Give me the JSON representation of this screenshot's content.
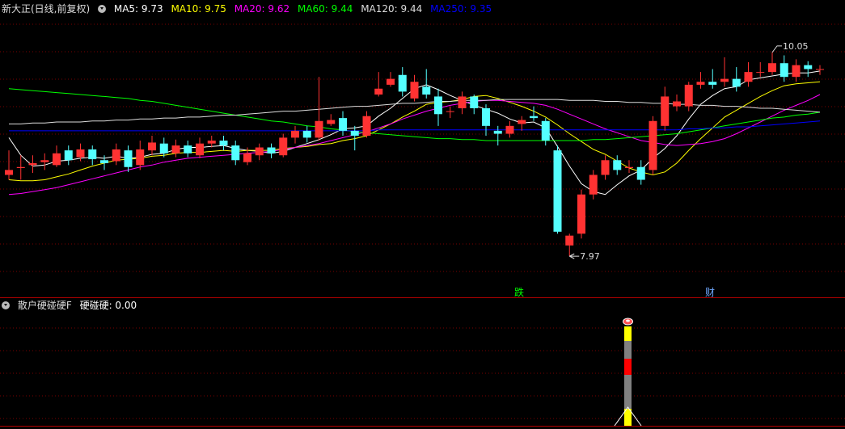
{
  "header": {
    "title": "新大正(日线,前复权)",
    "ma": [
      {
        "label": "MA5: 9.73",
        "color": "#ffffff"
      },
      {
        "label": "MA10: 9.75",
        "color": "#ffff00"
      },
      {
        "label": "MA20: 9.62",
        "color": "#ff00ff"
      },
      {
        "label": "MA60: 9.44",
        "color": "#00ff00"
      },
      {
        "label": "MA120: 9.44",
        "color": "#dddddd"
      },
      {
        "label": "MA250: 9.35",
        "color": "#0000ff"
      }
    ]
  },
  "indicator": {
    "title": "散户硬碰硬F",
    "value_label": "硬碰硬: 0.00"
  },
  "annotations": {
    "high": "10.05",
    "low": "7.97",
    "marker_die": "跌",
    "marker_cai": "财"
  },
  "chart_data": {
    "type": "candlestick",
    "ylim": [
      7.6,
      10.42
    ],
    "up_color": "#ff3232",
    "down_color": "#54ffff",
    "candles": [
      [
        8.8,
        8.85,
        9.05,
        8.75
      ],
      [
        8.87,
        8.88,
        9.0,
        8.75
      ],
      [
        8.9,
        8.92,
        9.0,
        8.82
      ],
      [
        8.93,
        8.95,
        9.02,
        8.85
      ],
      [
        8.9,
        9.02,
        9.1,
        8.88
      ],
      [
        9.05,
        8.95,
        9.1,
        8.9
      ],
      [
        8.98,
        9.06,
        9.12,
        8.94
      ],
      [
        9.06,
        8.96,
        9.1,
        8.9
      ],
      [
        8.95,
        8.92,
        9.0,
        8.85
      ],
      [
        8.94,
        9.06,
        9.12,
        8.9
      ],
      [
        9.05,
        8.88,
        9.1,
        8.83
      ],
      [
        8.9,
        9.06,
        9.15,
        8.85
      ],
      [
        9.05,
        9.13,
        9.2,
        9.0
      ],
      [
        9.12,
        9.02,
        9.18,
        8.98
      ],
      [
        9.02,
        9.1,
        9.16,
        8.98
      ],
      [
        9.1,
        9.02,
        9.15,
        8.98
      ],
      [
        9.0,
        9.12,
        9.18,
        8.97
      ],
      [
        9.12,
        9.15,
        9.2,
        9.08
      ],
      [
        9.15,
        9.1,
        9.2,
        9.05
      ],
      [
        9.1,
        8.95,
        9.15,
        8.9
      ],
      [
        8.93,
        9.02,
        9.08,
        8.9
      ],
      [
        9.0,
        9.08,
        9.12,
        8.95
      ],
      [
        9.08,
        9.02,
        9.12,
        8.97
      ],
      [
        9.0,
        9.18,
        9.22,
        8.98
      ],
      [
        9.18,
        9.25,
        9.3,
        9.12
      ],
      [
        9.25,
        9.18,
        9.3,
        9.13
      ],
      [
        9.18,
        9.35,
        9.8,
        9.15
      ],
      [
        9.32,
        9.36,
        9.42,
        9.3
      ],
      [
        9.38,
        9.25,
        9.45,
        9.2
      ],
      [
        9.25,
        9.2,
        9.3,
        9.05
      ],
      [
        9.2,
        9.4,
        9.45,
        9.18
      ],
      [
        9.62,
        9.68,
        9.85,
        9.6
      ],
      [
        9.72,
        9.78,
        9.85,
        9.7
      ],
      [
        9.82,
        9.65,
        9.9,
        9.6
      ],
      [
        9.58,
        9.75,
        9.82,
        9.55
      ],
      [
        9.7,
        9.62,
        9.88,
        9.58
      ],
      [
        9.6,
        9.42,
        9.68,
        9.3
      ],
      [
        9.45,
        9.45,
        9.5,
        9.38
      ],
      [
        9.48,
        9.6,
        9.65,
        9.42
      ],
      [
        9.6,
        9.48,
        9.62,
        9.42
      ],
      [
        9.48,
        9.3,
        9.52,
        9.2
      ],
      [
        9.25,
        9.22,
        9.3,
        9.1
      ],
      [
        9.22,
        9.3,
        9.35,
        9.18
      ],
      [
        9.32,
        9.36,
        9.4,
        9.25
      ],
      [
        9.4,
        9.38,
        9.5,
        9.35
      ],
      [
        9.35,
        9.15,
        9.38,
        9.1
      ],
      [
        9.05,
        8.22,
        9.1,
        8.2
      ],
      [
        8.08,
        8.18,
        8.2,
        7.97
      ],
      [
        8.2,
        8.6,
        8.65,
        8.15
      ],
      [
        8.6,
        8.8,
        8.85,
        8.55
      ],
      [
        8.8,
        8.95,
        9.0,
        8.75
      ],
      [
        8.95,
        8.85,
        9.0,
        8.8
      ],
      [
        8.87,
        8.88,
        8.95,
        8.82
      ],
      [
        8.88,
        8.75,
        8.95,
        8.7
      ],
      [
        8.85,
        9.35,
        9.4,
        8.8
      ],
      [
        9.3,
        9.6,
        9.7,
        9.25
      ],
      [
        9.5,
        9.55,
        9.62,
        9.45
      ],
      [
        9.5,
        9.72,
        9.75,
        9.45
      ],
      [
        9.72,
        9.75,
        9.85,
        9.68
      ],
      [
        9.75,
        9.72,
        9.88,
        9.68
      ],
      [
        9.75,
        9.78,
        10.0,
        9.7
      ],
      [
        9.78,
        9.7,
        9.9,
        9.65
      ],
      [
        9.75,
        9.85,
        9.95,
        9.7
      ],
      [
        9.85,
        9.85,
        9.95,
        9.8
      ],
      [
        9.85,
        9.94,
        10.05,
        9.82
      ],
      [
        9.94,
        9.8,
        10.02,
        9.75
      ],
      [
        9.8,
        9.92,
        9.98,
        9.75
      ],
      [
        9.92,
        9.88,
        9.96,
        9.8
      ],
      [
        9.88,
        9.88,
        9.92,
        9.82
      ]
    ],
    "ma_lines": [
      {
        "name": "MA5",
        "color": "#ffffff",
        "values": [
          9.18,
          9.0,
          8.89,
          8.9,
          8.94,
          8.95,
          8.97,
          8.98,
          8.97,
          8.99,
          8.97,
          8.98,
          9.01,
          9.02,
          9.06,
          9.08,
          9.08,
          9.09,
          9.1,
          9.07,
          9.05,
          9.04,
          9.02,
          9.04,
          9.08,
          9.12,
          9.16,
          9.21,
          9.27,
          9.28,
          9.3,
          9.4,
          9.48,
          9.58,
          9.68,
          9.72,
          9.67,
          9.61,
          9.56,
          9.51,
          9.47,
          9.43,
          9.37,
          9.33,
          9.34,
          9.28,
          9.09,
          8.89,
          8.71,
          8.63,
          8.6,
          8.7,
          8.79,
          8.85,
          8.97,
          9.07,
          9.2,
          9.37,
          9.52,
          9.61,
          9.68,
          9.7,
          9.77,
          9.79,
          9.81,
          9.83,
          9.84,
          9.84,
          9.86
        ]
      },
      {
        "name": "MA10",
        "color": "#ffff00",
        "values": [
          8.75,
          8.74,
          8.74,
          8.75,
          8.78,
          8.81,
          8.85,
          8.89,
          8.92,
          8.95,
          8.96,
          8.97,
          8.99,
          9.0,
          9.02,
          9.03,
          9.03,
          9.04,
          9.05,
          9.04,
          9.05,
          9.05,
          9.05,
          9.07,
          9.08,
          9.09,
          9.11,
          9.12,
          9.15,
          9.17,
          9.2,
          9.26,
          9.32,
          9.39,
          9.45,
          9.52,
          9.54,
          9.55,
          9.57,
          9.6,
          9.61,
          9.58,
          9.54,
          9.5,
          9.45,
          9.39,
          9.31,
          9.22,
          9.14,
          9.06,
          9.01,
          8.94,
          8.87,
          8.83,
          8.8,
          8.83,
          8.92,
          9.05,
          9.17,
          9.28,
          9.39,
          9.46,
          9.53,
          9.6,
          9.66,
          9.71,
          9.73,
          9.74,
          9.75
        ]
      },
      {
        "name": "MA20",
        "color": "#ff00ff",
        "values": [
          8.6,
          8.61,
          8.63,
          8.65,
          8.67,
          8.7,
          8.73,
          8.76,
          8.79,
          8.82,
          8.85,
          8.88,
          8.9,
          8.93,
          8.95,
          8.97,
          8.98,
          8.99,
          9.0,
          9.01,
          9.02,
          9.03,
          9.04,
          9.06,
          9.08,
          9.1,
          9.12,
          9.15,
          9.18,
          9.21,
          9.24,
          9.28,
          9.32,
          9.37,
          9.41,
          9.45,
          9.48,
          9.51,
          9.53,
          9.55,
          9.56,
          9.56,
          9.55,
          9.54,
          9.53,
          9.51,
          9.47,
          9.42,
          9.37,
          9.32,
          9.27,
          9.23,
          9.19,
          9.15,
          9.13,
          9.11,
          9.1,
          9.11,
          9.12,
          9.14,
          9.17,
          9.22,
          9.28,
          9.34,
          9.4,
          9.46,
          9.51,
          9.56,
          9.62
        ]
      },
      {
        "name": "MA60",
        "color": "#00ff00",
        "values": [
          9.68,
          9.67,
          9.66,
          9.65,
          9.64,
          9.63,
          9.62,
          9.61,
          9.6,
          9.59,
          9.58,
          9.56,
          9.55,
          9.53,
          9.51,
          9.49,
          9.47,
          9.45,
          9.43,
          9.41,
          9.39,
          9.37,
          9.35,
          9.34,
          9.32,
          9.3,
          9.29,
          9.27,
          9.26,
          9.24,
          9.23,
          9.22,
          9.21,
          9.2,
          9.19,
          9.18,
          9.17,
          9.17,
          9.16,
          9.16,
          9.15,
          9.15,
          9.15,
          9.15,
          9.15,
          9.15,
          9.15,
          9.15,
          9.15,
          9.16,
          9.16,
          9.17,
          9.18,
          9.19,
          9.2,
          9.21,
          9.22,
          9.24,
          9.26,
          9.28,
          9.3,
          9.32,
          9.34,
          9.36,
          9.38,
          9.39,
          9.41,
          9.42,
          9.44
        ]
      },
      {
        "name": "MA120",
        "color": "#dddddd",
        "values": [
          9.32,
          9.32,
          9.33,
          9.33,
          9.34,
          9.34,
          9.34,
          9.35,
          9.35,
          9.36,
          9.36,
          9.37,
          9.37,
          9.38,
          9.38,
          9.39,
          9.39,
          9.4,
          9.41,
          9.41,
          9.42,
          9.43,
          9.44,
          9.45,
          9.45,
          9.46,
          9.47,
          9.48,
          9.49,
          9.5,
          9.5,
          9.51,
          9.52,
          9.53,
          9.53,
          9.54,
          9.55,
          9.55,
          9.56,
          9.56,
          9.56,
          9.57,
          9.57,
          9.57,
          9.57,
          9.57,
          9.57,
          9.56,
          9.56,
          9.56,
          9.55,
          9.55,
          9.54,
          9.54,
          9.53,
          9.53,
          9.52,
          9.52,
          9.51,
          9.51,
          9.5,
          9.5,
          9.49,
          9.48,
          9.48,
          9.47,
          9.46,
          9.45,
          9.44
        ]
      },
      {
        "name": "MA250",
        "color": "#0000ff",
        "values": [
          9.25,
          9.25,
          9.25,
          9.25,
          9.25,
          9.25,
          9.25,
          9.25,
          9.25,
          9.25,
          9.25,
          9.25,
          9.25,
          9.25,
          9.25,
          9.25,
          9.25,
          9.25,
          9.25,
          9.25,
          9.25,
          9.25,
          9.25,
          9.25,
          9.25,
          9.25,
          9.25,
          9.25,
          9.25,
          9.25,
          9.25,
          9.26,
          9.26,
          9.26,
          9.26,
          9.26,
          9.26,
          9.26,
          9.26,
          9.26,
          9.26,
          9.26,
          9.26,
          9.26,
          9.26,
          9.26,
          9.26,
          9.26,
          9.26,
          9.26,
          9.26,
          9.26,
          9.26,
          9.26,
          9.26,
          9.26,
          9.26,
          9.27,
          9.27,
          9.28,
          9.28,
          9.29,
          9.29,
          9.3,
          9.31,
          9.32,
          9.33,
          9.34,
          9.35
        ]
      }
    ]
  }
}
